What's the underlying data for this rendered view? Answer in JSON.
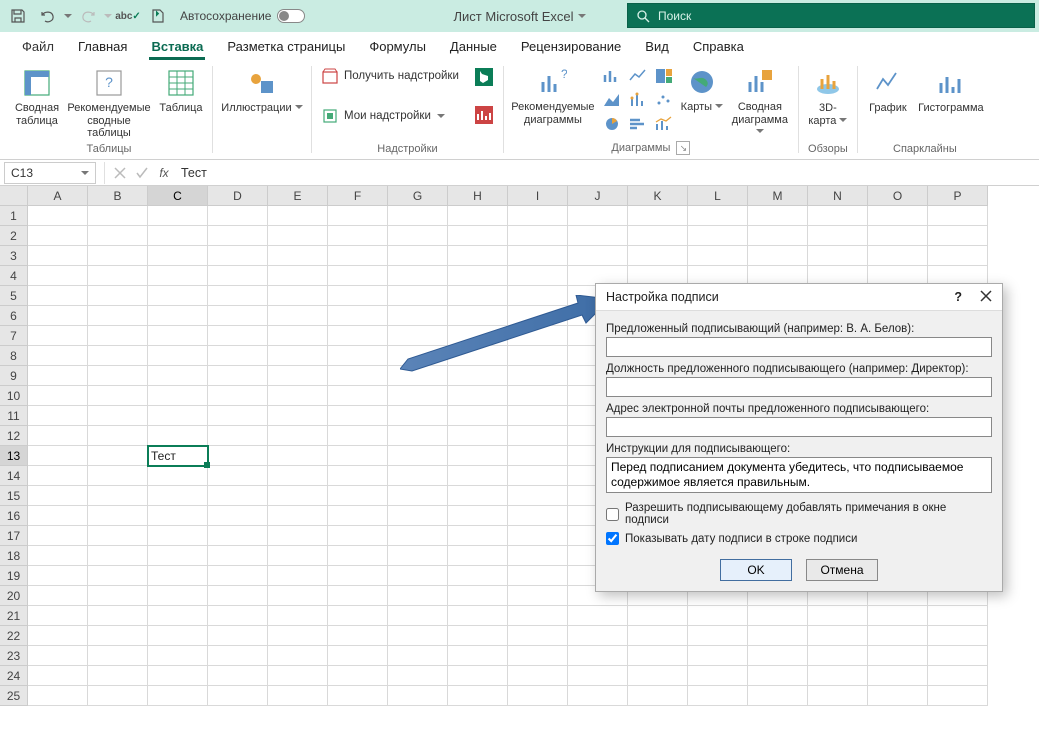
{
  "titlebar": {
    "autosave_label": "Автосохранение",
    "doc_title": "Лист Microsoft Excel",
    "search_placeholder": "Поиск"
  },
  "tabs": {
    "file": "Файл",
    "home": "Главная",
    "insert": "Вставка",
    "layout": "Разметка страницы",
    "formulas": "Формулы",
    "data": "Данные",
    "review": "Рецензирование",
    "view": "Вид",
    "help": "Справка"
  },
  "ribbon": {
    "tables": {
      "pivot": "Сводная\nтаблица",
      "recommended": "Рекомендуемые\nсводные таблицы",
      "table": "Таблица",
      "group": "Таблицы"
    },
    "illustrations": {
      "label": "Иллюстрации"
    },
    "addins": {
      "get": "Получить надстройки",
      "mine": "Мои надстройки",
      "group": "Надстройки"
    },
    "charts": {
      "recommended": "Рекомендуемые\nдиаграммы",
      "maps": "Карты",
      "pivotchart": "Сводная\nдиаграмма",
      "group": "Диаграммы"
    },
    "tours": {
      "map3d": "3D-\nкарта",
      "group": "Обзоры"
    },
    "sparklines": {
      "line": "График",
      "histogram": "Гистограмма",
      "group": "Спарклайны"
    }
  },
  "formula_bar": {
    "name": "C13",
    "value": "Тест"
  },
  "grid": {
    "columns": [
      "A",
      "B",
      "C",
      "D",
      "E",
      "F",
      "G",
      "H",
      "I",
      "J",
      "K",
      "L",
      "M",
      "N",
      "O",
      "P"
    ],
    "rows": 25,
    "selected": {
      "row": 13,
      "col": "C",
      "value": "Тест"
    }
  },
  "dialog": {
    "title": "Настройка подписи",
    "label_signer": "Предложенный подписывающий (например: В. А. Белов):",
    "val_signer": "",
    "label_role": "Должность предложенного подписывающего (например: Директор):",
    "val_role": "",
    "label_email": "Адрес электронной почты предложенного подписывающего:",
    "val_email": "",
    "label_instr": "Инструкции для подписывающего:",
    "val_instr": "Перед подписанием документа убедитесь, что подписываемое содержимое является правильным.",
    "check_comments": "Разрешить подписывающему добавлять примечания в окне подписи",
    "check_date": "Показывать дату подписи в строке подписи",
    "ok": "OK",
    "cancel": "Отмена"
  }
}
